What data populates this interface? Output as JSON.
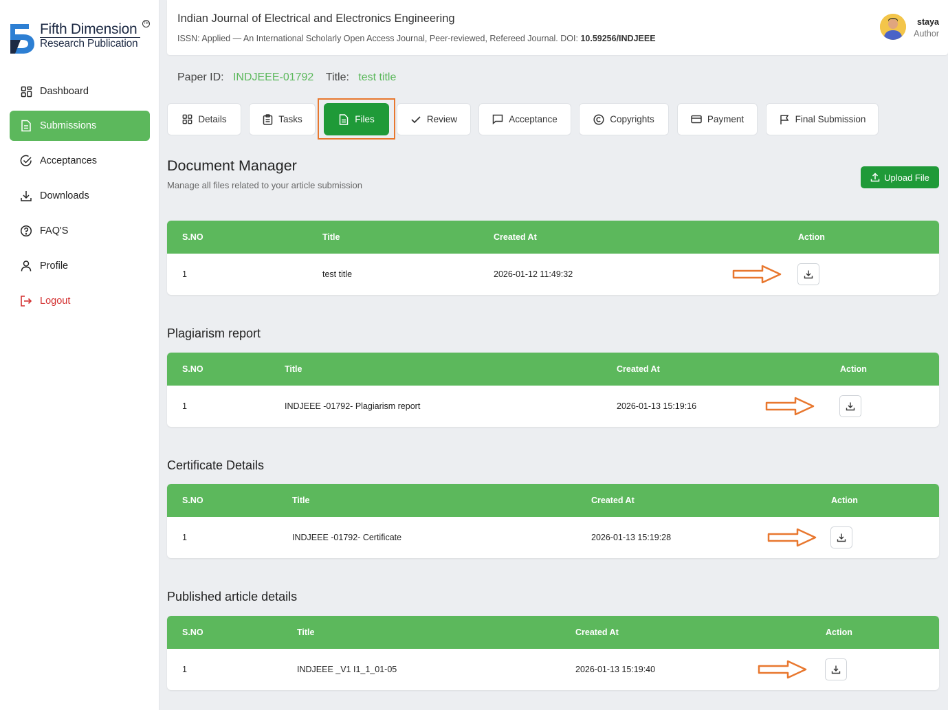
{
  "brand": {
    "line1": "Fifth Dimension",
    "line2": "Research Publication",
    "tm": "TM"
  },
  "sidebar": {
    "items": [
      {
        "label": "Dashboard",
        "icon": "grid-icon"
      },
      {
        "label": "Submissions",
        "icon": "document-icon",
        "active": true
      },
      {
        "label": "Acceptances",
        "icon": "check-circle-icon"
      },
      {
        "label": "Downloads",
        "icon": "download-icon"
      },
      {
        "label": "FAQ'S",
        "icon": "help-circle-icon"
      },
      {
        "label": "Profile",
        "icon": "user-icon"
      },
      {
        "label": "Logout",
        "icon": "logout-icon"
      }
    ]
  },
  "header": {
    "journal_title": "Indian Journal of Electrical and Electronics Engineering",
    "journal_sub": "ISSN: Applied — An International Scholarly Open Access Journal, Peer-reviewed, Refereed Journal. DOI:",
    "doi": "10.59256/INDJEEE",
    "user_name": "staya",
    "user_role": "Author"
  },
  "paper": {
    "id_label": "Paper ID:",
    "id_value": "INDJEEE-01792",
    "title_label": "Title:",
    "title_value": "test title"
  },
  "tabs": [
    {
      "label": "Details",
      "icon": "grid-icon"
    },
    {
      "label": "Tasks",
      "icon": "clipboard-icon"
    },
    {
      "label": "Files",
      "icon": "file-icon",
      "active": true
    },
    {
      "label": "Review",
      "icon": "check-icon"
    },
    {
      "label": "Acceptance",
      "icon": "message-icon"
    },
    {
      "label": "Copyrights",
      "icon": "copyright-icon"
    },
    {
      "label": "Payment",
      "icon": "card-icon"
    },
    {
      "label": "Final Submission",
      "icon": "flag-icon"
    }
  ],
  "document_manager": {
    "title": "Document Manager",
    "subtitle": "Manage all files related to your article submission",
    "upload_label": "Upload File"
  },
  "columns": {
    "sno": "S.NO",
    "title": "Title",
    "created": "Created At",
    "action": "Action"
  },
  "tables": [
    {
      "section": "",
      "row": {
        "sno": "1",
        "title": "test title",
        "created": "2026-01-12 11:49:32"
      }
    },
    {
      "section": "Plagiarism report",
      "row": {
        "sno": "1",
        "title": "INDJEEE -01792- Plagiarism report",
        "created": "2026-01-13 15:19:16"
      }
    },
    {
      "section": "Certificate Details",
      "row": {
        "sno": "1",
        "title": "INDJEEE -01792- Certificate",
        "created": "2026-01-13 15:19:28"
      }
    },
    {
      "section": "Published article details",
      "row": {
        "sno": "1",
        "title": "INDJEEE _V1 I1_1_01-05",
        "created": "2026-01-13 15:19:40"
      }
    }
  ],
  "colors": {
    "accent": "#5cb85c",
    "accent_dark": "#1f9a38",
    "highlight": "#e8772e",
    "logout": "#d32f2f"
  }
}
